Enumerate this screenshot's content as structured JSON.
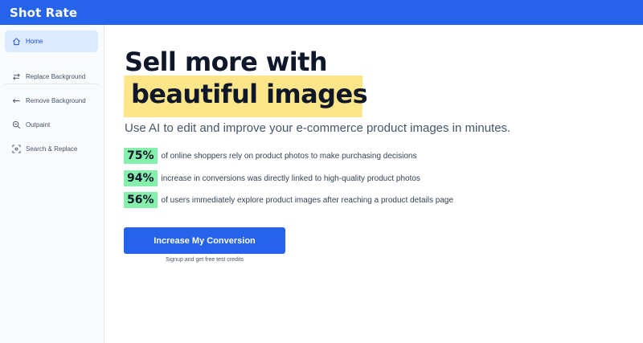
{
  "app": {
    "title": "Shot Rate"
  },
  "sidebar": {
    "items": [
      {
        "label": "Home",
        "icon": "home-icon",
        "active": true
      },
      {
        "label": "Replace Background",
        "icon": "swap-arrows-icon",
        "active": false
      },
      {
        "label": "Remove Background",
        "icon": "arrow-left-icon",
        "active": false
      },
      {
        "label": "Outpaint",
        "icon": "zoom-out-icon",
        "active": false
      },
      {
        "label": "Search & Replace",
        "icon": "scan-target-icon",
        "active": false
      }
    ]
  },
  "hero": {
    "headline_line1": "Sell more with",
    "headline_line2": "beautiful images",
    "subtitle": "Use AI to edit and improve your e-commerce product images in minutes.",
    "stats": [
      {
        "value": "75%",
        "text": "of online shoppers rely on product photos to make purchasing decisions"
      },
      {
        "value": "94%",
        "text": "increase in conversions was directly linked to high-quality product photos"
      },
      {
        "value": "56%",
        "text": "of users immediately explore product images after reaching a product details page"
      }
    ],
    "cta_label": "Increase My Conversion",
    "cta_note": "Signup and get free test credits"
  },
  "colors": {
    "accent": "#2563eb",
    "highlight": "#fde68a",
    "stat_badge": "#86efac",
    "active_nav": "#dbeafe"
  }
}
